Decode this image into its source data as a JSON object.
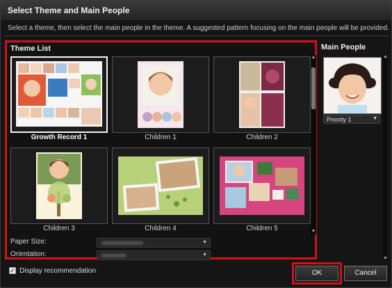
{
  "window": {
    "title": "Select Theme and Main People",
    "instruction": "Select a theme, then select the main people in the theme. A suggested pattern focusing on the main people will be provided."
  },
  "theme_list": {
    "heading": "Theme List",
    "selected_index": 0,
    "items": [
      {
        "label": "Growth Record 1"
      },
      {
        "label": "Children 1"
      },
      {
        "label": "Children 2"
      },
      {
        "label": "Children 3"
      },
      {
        "label": "Children 4"
      },
      {
        "label": "Children 5"
      }
    ]
  },
  "paper_size": {
    "label": "Paper Size:"
  },
  "orientation": {
    "label": "Orientation:"
  },
  "main_people": {
    "heading": "Main People",
    "priority": "Priority 1"
  },
  "footer": {
    "display_recommendation": "Display recommendation",
    "display_recommendation_checked": true,
    "ok_label": "OK",
    "cancel_label": "Cancel"
  },
  "colors": {
    "highlight": "#d21018",
    "background": "#151515"
  }
}
